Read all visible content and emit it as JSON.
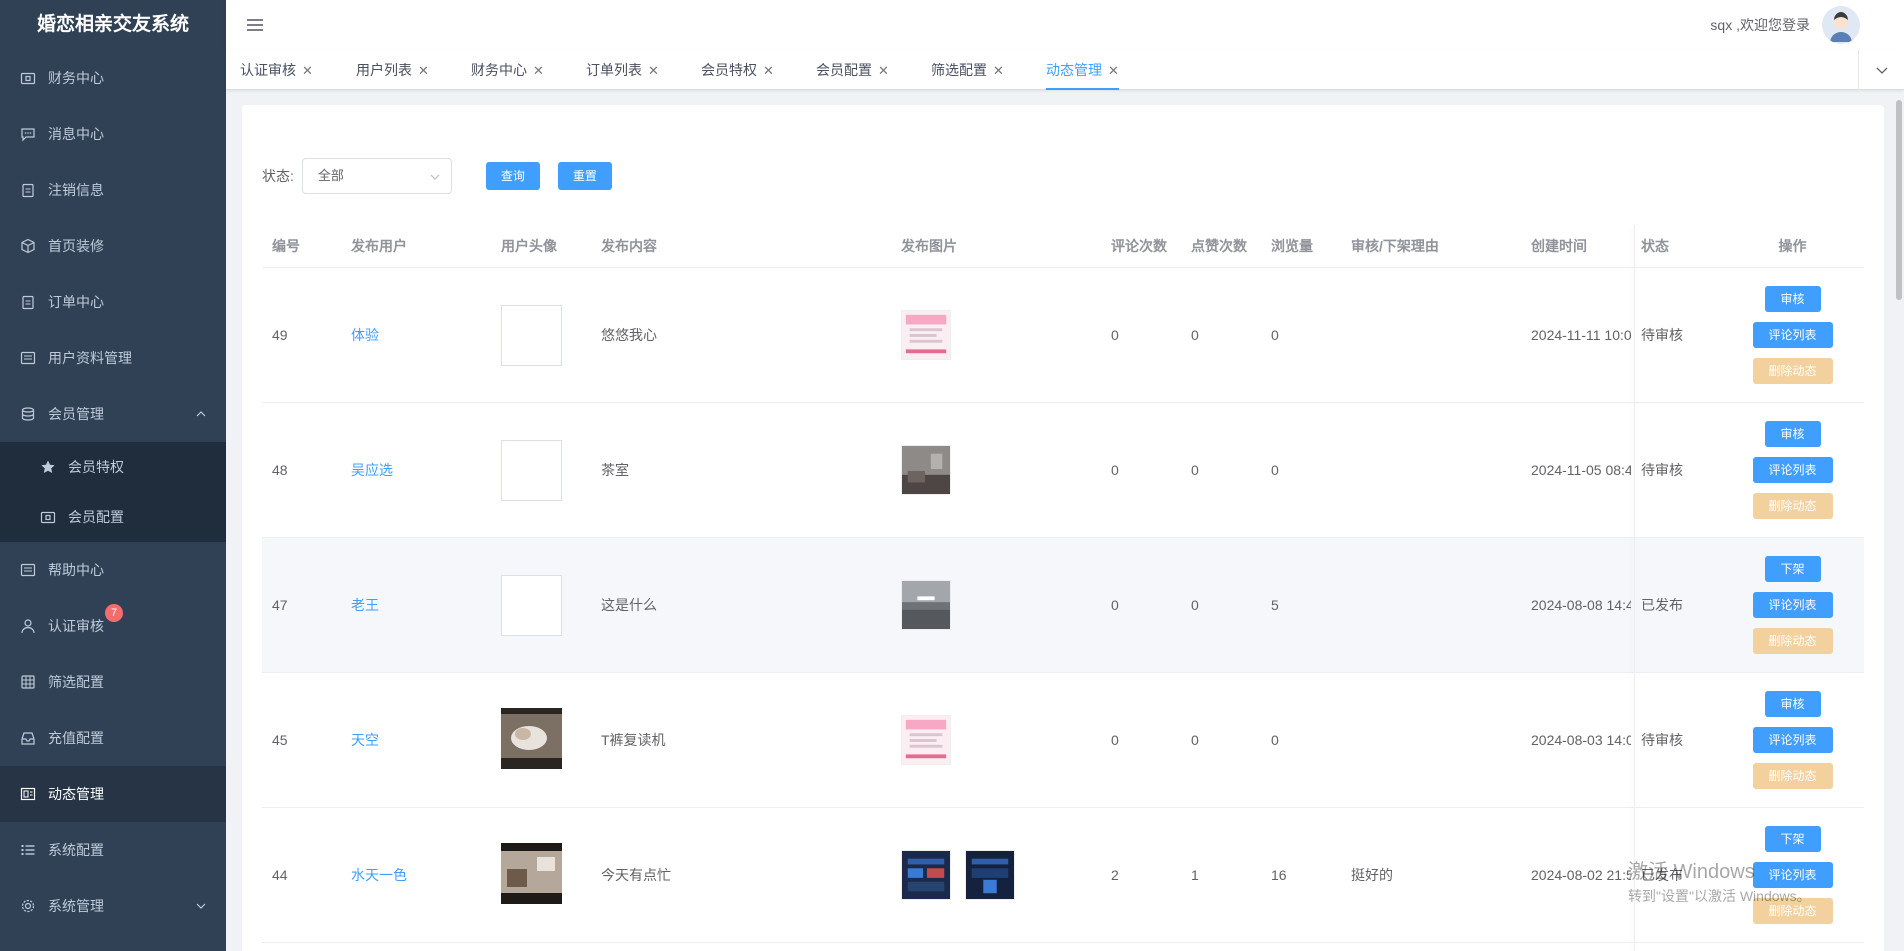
{
  "app": {
    "title": "婚恋相亲交友系统"
  },
  "sidebar": {
    "items": [
      {
        "label": "财务中心",
        "icon": "wallet-icon"
      },
      {
        "label": "消息中心",
        "icon": "message-icon"
      },
      {
        "label": "注销信息",
        "icon": "clipboard-icon"
      },
      {
        "label": "首页装修",
        "icon": "cube-icon"
      },
      {
        "label": "订单中心",
        "icon": "clipboard-icon"
      },
      {
        "label": "用户资料管理",
        "icon": "profile-card-icon"
      },
      {
        "label": "会员管理",
        "icon": "database-icon",
        "expanded": true
      },
      {
        "label": "帮助中心",
        "icon": "profile-card-icon"
      },
      {
        "label": "认证审核",
        "icon": "user-icon",
        "badge": "7"
      },
      {
        "label": "筛选配置",
        "icon": "grid-icon"
      },
      {
        "label": "充值配置",
        "icon": "inbox-icon"
      },
      {
        "label": "动态管理",
        "icon": "picture-icon",
        "active": true
      },
      {
        "label": "系统配置",
        "icon": "list-icon"
      },
      {
        "label": "系统管理",
        "icon": "gear-icon"
      }
    ],
    "submenu": [
      {
        "label": "会员特权",
        "icon": "star-icon"
      },
      {
        "label": "会员配置",
        "icon": "wallet-icon"
      }
    ]
  },
  "header": {
    "welcome": "sqx ,欢迎您登录"
  },
  "tags": [
    {
      "label": "认证审核"
    },
    {
      "label": "用户列表"
    },
    {
      "label": "财务中心"
    },
    {
      "label": "订单列表"
    },
    {
      "label": "会员特权"
    },
    {
      "label": "会员配置"
    },
    {
      "label": "筛选配置"
    },
    {
      "label": "动态管理",
      "active": true
    }
  ],
  "filter": {
    "status_label": "状态:",
    "status_value": "全部",
    "search_label": "查询",
    "reset_label": "重置"
  },
  "table": {
    "headers": {
      "id": "编号",
      "user": "发布用户",
      "avatar": "用户头像",
      "content": "发布内容",
      "images": "发布图片",
      "comments": "评论次数",
      "likes": "点赞次数",
      "views": "浏览量",
      "reason": "审核/下架理由",
      "created": "创建时间",
      "status": "状态",
      "ops": "操作"
    },
    "rows": [
      {
        "id": "49",
        "user": "体验",
        "content": "悠悠我心",
        "comments": "0",
        "likes": "0",
        "views": "0",
        "reason": "",
        "created": "2024-11-11 10:0",
        "status": "待审核",
        "op1": "审核",
        "op2": "评论列表",
        "op3": "删除动态"
      },
      {
        "id": "48",
        "user": "吴应选",
        "content": "茶室",
        "comments": "0",
        "likes": "0",
        "views": "0",
        "reason": "",
        "created": "2024-11-05 08:4",
        "status": "待审核",
        "op1": "审核",
        "op2": "评论列表",
        "op3": "删除动态"
      },
      {
        "id": "47",
        "user": "老王",
        "content": "这是什么",
        "comments": "0",
        "likes": "0",
        "views": "5",
        "reason": "",
        "created": "2024-08-08 14:4",
        "status": "已发布",
        "op1": "下架",
        "op2": "评论列表",
        "op3": "删除动态"
      },
      {
        "id": "45",
        "user": "天空",
        "content": "T裤复读机",
        "comments": "0",
        "likes": "0",
        "views": "0",
        "reason": "",
        "created": "2024-08-03 14:0",
        "status": "待审核",
        "op1": "审核",
        "op2": "评论列表",
        "op3": "删除动态"
      },
      {
        "id": "44",
        "user": "水天一色",
        "content": "今天有点忙",
        "comments": "2",
        "likes": "1",
        "views": "16",
        "reason": "挺好的",
        "created": "2024-08-02 21:5",
        "status": "已发布",
        "op1": "下架",
        "op2": "评论列表",
        "op3": "删除动态"
      }
    ]
  },
  "watermark": {
    "line1": "激活 Windows",
    "line2": "转到\"设置\"以激活 Windows。"
  },
  "colors": {
    "sidebar_bg": "#304156",
    "primary": "#409eff",
    "danger_light": "#f3d19e",
    "badge": "#f56c6c"
  }
}
